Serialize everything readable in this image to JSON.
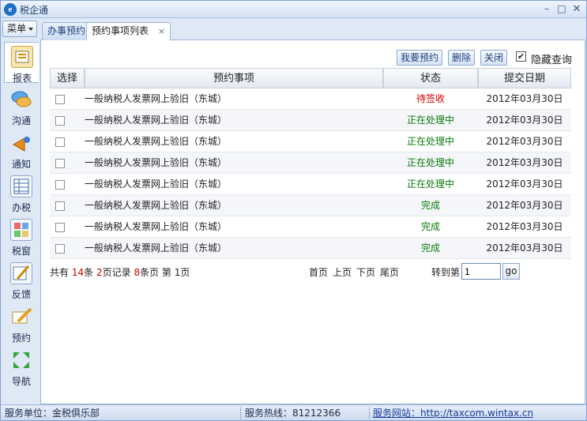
{
  "window": {
    "title": "税企通"
  },
  "menu": {
    "label": "菜单"
  },
  "sidebar": {
    "items": [
      {
        "label": "报表",
        "icon": "report-icon"
      },
      {
        "label": "沟通",
        "icon": "chat-icon"
      },
      {
        "label": "通知",
        "icon": "notice-icon"
      },
      {
        "label": "办税",
        "icon": "tax-icon"
      },
      {
        "label": "税窗",
        "icon": "window-icon"
      },
      {
        "label": "反馈",
        "icon": "feedback-icon"
      },
      {
        "label": "预约",
        "icon": "booking-icon"
      },
      {
        "label": "导航",
        "icon": "navigation-icon"
      }
    ]
  },
  "tabs": [
    {
      "label": "办事预约"
    },
    {
      "label": "预约事项列表",
      "close": "×"
    }
  ],
  "toolbar": {
    "my_booking": "我要预约",
    "delete": "删除",
    "close": "关闭",
    "hide_query": "隐藏查询",
    "hide_checked": "✔"
  },
  "table": {
    "headers": {
      "select": "选择",
      "item": "预约事项",
      "status": "状态",
      "date": "提交日期"
    },
    "rows": [
      {
        "item": "一般纳税人发票网上验旧（东城）",
        "status": "待签收",
        "date": "2012年03月30日"
      },
      {
        "item": "一般纳税人发票网上验旧（东城）",
        "status": "正在处理中",
        "date": "2012年03月30日"
      },
      {
        "item": "一般纳税人发票网上验旧（东城）",
        "status": "正在处理中",
        "date": "2012年03月30日"
      },
      {
        "item": "一般纳税人发票网上验旧（东城）",
        "status": "正在处理中",
        "date": "2012年03月30日"
      },
      {
        "item": "一般纳税人发票网上验旧（东城）",
        "status": "正在处理中",
        "date": "2012年03月30日"
      },
      {
        "item": "一般纳税人发票网上验旧（东城）",
        "status": "完成",
        "date": "2012年03月30日"
      },
      {
        "item": "一般纳税人发票网上验旧（东城）",
        "status": "完成",
        "date": "2012年03月30日"
      },
      {
        "item": "一般纳税人发票网上验旧（东城）",
        "status": "完成",
        "date": "2012年03月30日"
      }
    ]
  },
  "pager": {
    "total_prefix": "共有",
    "total": "14",
    "total_suffix": "条",
    "pages": "2",
    "pages_suffix": "页记录",
    "per_page": "8",
    "per_page_suffix": "条页 第",
    "current": "1",
    "current_suffix": "页",
    "first": "首页",
    "prev": "上页",
    "next": "下页",
    "last": "尾页",
    "goto_label": "转到第",
    "goto_value": "1",
    "go": "go"
  },
  "statusbar": {
    "unit": "服务单位：金税俱乐部",
    "hotline": "服务热线：81212366",
    "site_label": "服务网站：",
    "site_url": "http://taxcom.wintax.cn"
  },
  "colors": {
    "red": "#d40000",
    "green": "#0a7a0a",
    "accent": "#1f6fc5"
  }
}
